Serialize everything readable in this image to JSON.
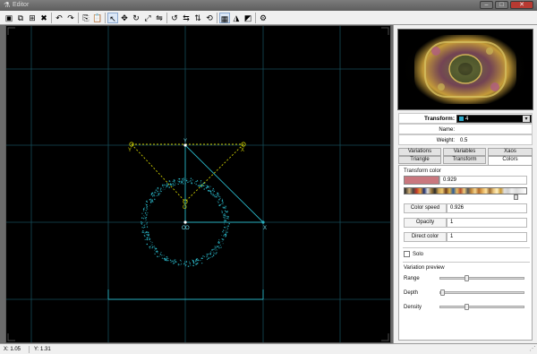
{
  "window": {
    "title": "Editor",
    "icon": "editor-app-icon",
    "minimize_label": "–",
    "maximize_label": "□",
    "close_label": "✕"
  },
  "toolbar": {
    "buttons": [
      {
        "name": "new-transform-button",
        "icon": "new-icon",
        "glyph": "▣"
      },
      {
        "name": "duplicate-transform-button",
        "icon": "duplicate-icon",
        "glyph": "⧉"
      },
      {
        "name": "add-linked-button",
        "icon": "link-icon",
        "glyph": "⊞"
      },
      {
        "name": "delete-transform-button",
        "icon": "delete-icon",
        "glyph": "✖"
      },
      {
        "name": "undo-button",
        "icon": "undo-icon",
        "glyph": "↶"
      },
      {
        "name": "redo-button",
        "icon": "redo-icon",
        "glyph": "↷"
      },
      {
        "name": "copy-button",
        "icon": "copy-icon",
        "glyph": "⎘"
      },
      {
        "name": "paste-button",
        "icon": "paste-icon",
        "glyph": "📋"
      },
      {
        "name": "select-mode-button",
        "icon": "pointer-icon",
        "glyph": "↖"
      },
      {
        "name": "move-mode-button",
        "icon": "move-icon",
        "glyph": "✥"
      },
      {
        "name": "rotate-mode-button",
        "icon": "rotate-icon",
        "glyph": "↻"
      },
      {
        "name": "scale-mode-button",
        "icon": "scale-icon",
        "glyph": "⤢"
      },
      {
        "name": "flip-mode-button",
        "icon": "flip-icon",
        "glyph": "⇋"
      },
      {
        "name": "rotate-left-button",
        "icon": "rotate-left-icon",
        "glyph": "↺"
      },
      {
        "name": "flip-horizontal-button",
        "icon": "flip-horizontal-icon",
        "glyph": "⇆"
      },
      {
        "name": "flip-vertical-button",
        "icon": "flip-vertical-icon",
        "glyph": "⇅"
      },
      {
        "name": "reset-button",
        "icon": "reset-icon",
        "glyph": "⟲"
      },
      {
        "name": "toggle-grid-button",
        "icon": "grid-icon",
        "glyph": "▦"
      },
      {
        "name": "toggle-triangles-button",
        "icon": "triangle-icon",
        "glyph": "◮"
      },
      {
        "name": "toggle-preview-button",
        "icon": "preview-icon",
        "glyph": "◩"
      },
      {
        "name": "options-button",
        "icon": "options-icon",
        "glyph": "⚙"
      }
    ]
  },
  "properties": {
    "transform_label": "Transform:",
    "transform_value": "4",
    "name_label": "Name:",
    "name_value": "",
    "weight_label": "Weight:",
    "weight_value": "0.5"
  },
  "tabs": {
    "variations": "Variations",
    "variables": "Variables",
    "xaos": "Xaos",
    "triangle": "Triangle",
    "transform": "Transform",
    "colors": "Colors",
    "active": "Colors"
  },
  "colors_panel": {
    "transform_color_label": "Transform color",
    "transform_color_value": "0.929",
    "swatch_color": "#c9777e",
    "gradient_position": 0.929,
    "color_speed_label": "Color speed",
    "color_speed_value": "0.926",
    "opacity_label": "Opacity",
    "opacity_value": "1",
    "direct_color_label": "Direct color",
    "direct_color_value": "1",
    "solo_label": "Solo",
    "solo_checked": false,
    "variation_preview_label": "Variation preview",
    "range_label": "Range",
    "range_level": 0.3,
    "depth_label": "Depth",
    "depth_level": 0.0,
    "density_label": "Density",
    "density_level": 0.3
  },
  "canvas": {
    "background": "#000000",
    "grid_color": "#1a5f6e",
    "triangle_color": "#28b0c0",
    "reference_color": "#c8c800",
    "label_o": "O",
    "label_x": "X",
    "label_y": "Y"
  },
  "status": {
    "x": "X: 1.05",
    "y": "Y: 1.31"
  }
}
